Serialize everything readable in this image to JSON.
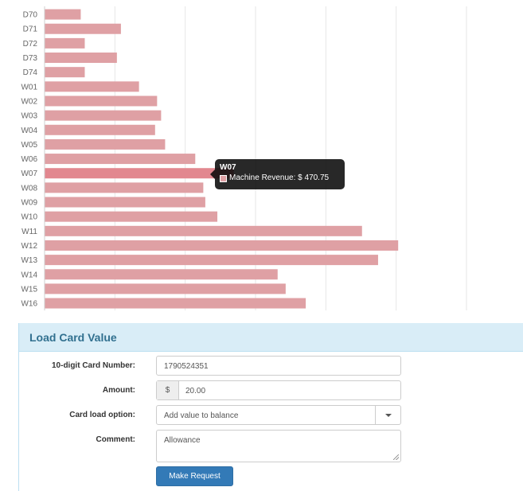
{
  "chart_data": {
    "type": "bar",
    "orientation": "horizontal",
    "categories": [
      "D70",
      "D71",
      "D72",
      "D73",
      "D74",
      "W01",
      "W02",
      "W03",
      "W04",
      "W05",
      "W06",
      "W07",
      "W08",
      "W09",
      "W10",
      "W11",
      "W12",
      "W13",
      "W14",
      "W15",
      "W16"
    ],
    "series": [
      {
        "name": "Machine Revenue",
        "values": [
          90,
          190,
          100,
          180,
          100,
          235,
          280,
          290,
          275,
          300,
          375,
          470.75,
          395,
          400,
          430,
          790,
          880,
          830,
          580,
          600,
          650
        ]
      }
    ],
    "xlim": [
      0,
      1050
    ],
    "grid": true,
    "bar_color": "#dfa0a4",
    "highlight_color": "#e2878f",
    "highlight_index": 11,
    "tooltip": {
      "title": "W07",
      "label": "Machine Revenue: $ 470.75"
    }
  },
  "form": {
    "title": "Load Card Value",
    "card_number": {
      "label": "10-digit Card Number:",
      "value": "1790524351"
    },
    "amount": {
      "label": "Amount:",
      "prefix": "$",
      "value": "20.00"
    },
    "load_option": {
      "label": "Card load option:",
      "value": "Add value to balance"
    },
    "comment": {
      "label": "Comment:",
      "value": "Allowance"
    },
    "submit_label": "Make Request"
  }
}
